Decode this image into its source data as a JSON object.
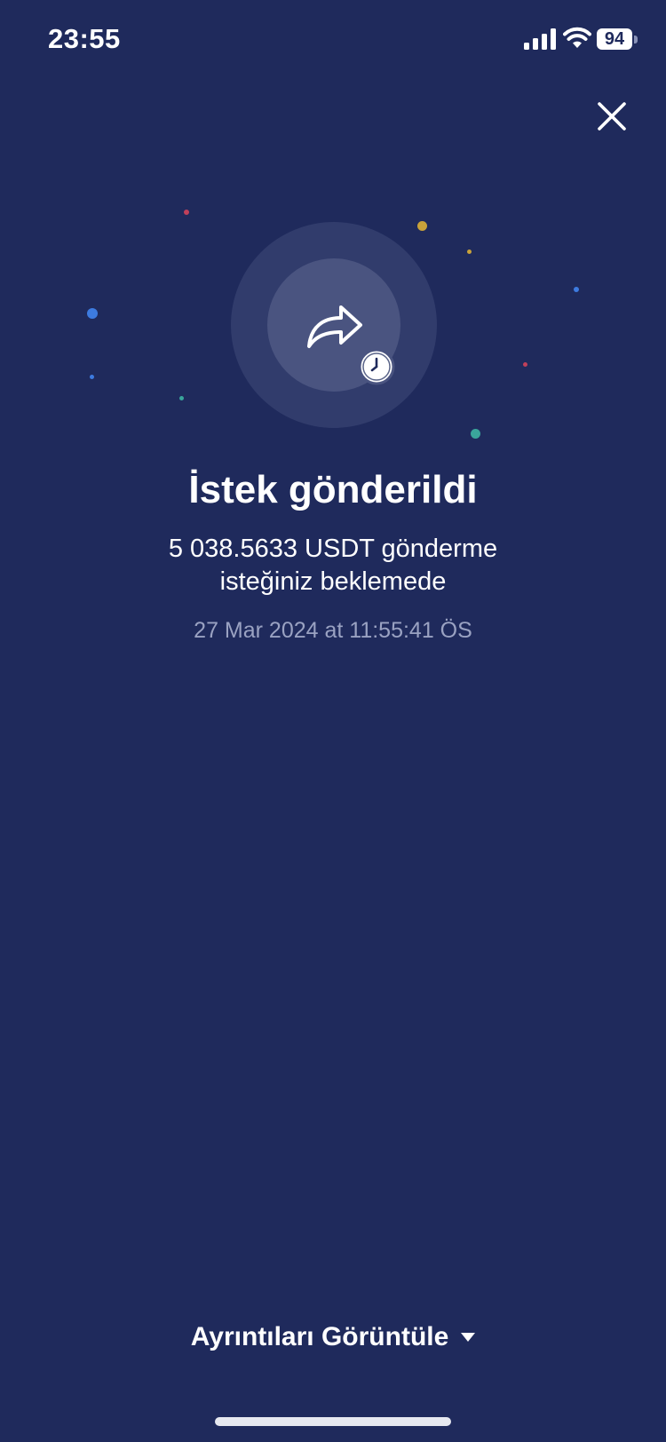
{
  "status_bar": {
    "time": "23:55",
    "battery_level": "94",
    "icons": [
      "signal-icon",
      "wifi-icon",
      "battery-icon"
    ]
  },
  "header": {
    "close_icon": "close-icon"
  },
  "illustration": {
    "main_icon": "share-forward-icon",
    "badge_icon": "clock-icon"
  },
  "result": {
    "title": "İstek gönderildi",
    "message_line1": "5 038.5633 USDT gönderme",
    "message_line2": "isteğiniz beklemede",
    "timestamp": "27 Mar 2024 at 11:55:41 ÖS"
  },
  "footer": {
    "details_label": "Ayrıntıları Görüntüle",
    "details_icon": "caret-down-icon"
  },
  "colors": {
    "background": "#1f2a5c",
    "outer_ring": "#313c6c",
    "inner_circle": "#4a5480",
    "muted_text": "#9aa2c2"
  }
}
